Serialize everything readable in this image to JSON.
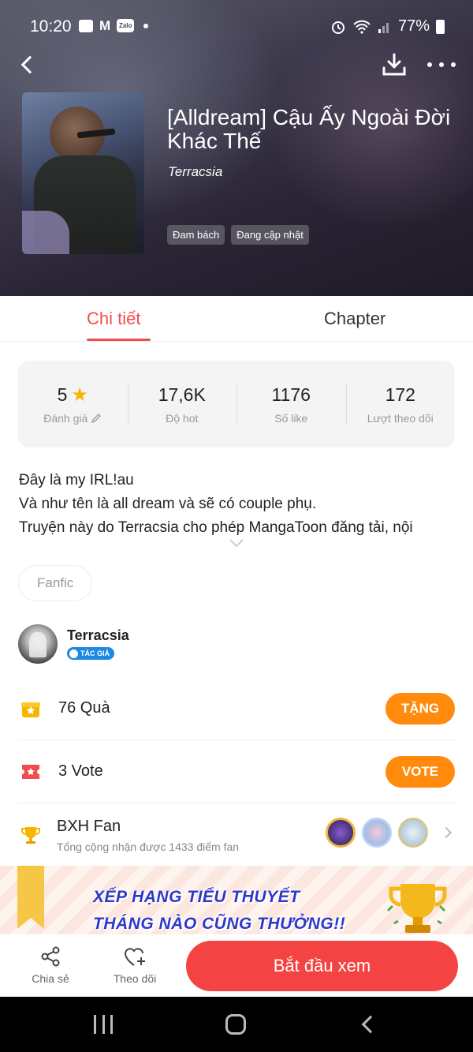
{
  "status_bar": {
    "time": "10:20",
    "zalo_label": "Zalo",
    "m_label": "M",
    "battery": "77%"
  },
  "book": {
    "title": "[Alldream] Cậu Ấy Ngoài Đời Khác Thế",
    "author": "Terracsia",
    "tags": [
      "Đam bách",
      "Đang cập nhật"
    ]
  },
  "tabs": [
    {
      "label": "Chi tiết",
      "active": true
    },
    {
      "label": "Chapter",
      "active": false
    }
  ],
  "stats": [
    {
      "value": "5",
      "label": "Đánh giá"
    },
    {
      "value": "17,6K",
      "label": "Độ hot"
    },
    {
      "value": "1176",
      "label": "Số like"
    },
    {
      "value": "172",
      "label": "Lượt theo dõi"
    }
  ],
  "description": [
    "Đây là my IRL!au",
    "Và như tên là all dream và sẽ có couple phụ.",
    "Truyện này do Terracsia cho phép MangaToon đăng tải, nội"
  ],
  "genre": "Fanfic",
  "author_block": {
    "name": "Terracsia",
    "badge": "TÁC GIẢ"
  },
  "gifts": {
    "count_text": "76 Quà",
    "button": "TẶNG"
  },
  "votes": {
    "count_text": "3 Vote",
    "button": "VOTE"
  },
  "fan_rank": {
    "title": "BXH Fan",
    "subtitle": "Tổng cộng nhận được 1433 điểm fan"
  },
  "banner": {
    "line1": "XẾP HẠNG TIỂU THUYẾT",
    "line2": "THÁNG NÀO CŨNG THƯỞNG!!"
  },
  "actions": {
    "share": "Chia sẻ",
    "follow": "Theo dõi",
    "start": "Bắt đầu xem"
  },
  "colors": {
    "accent": "#f44343",
    "orange": "#ff8a0c",
    "star": "#f7b500"
  }
}
